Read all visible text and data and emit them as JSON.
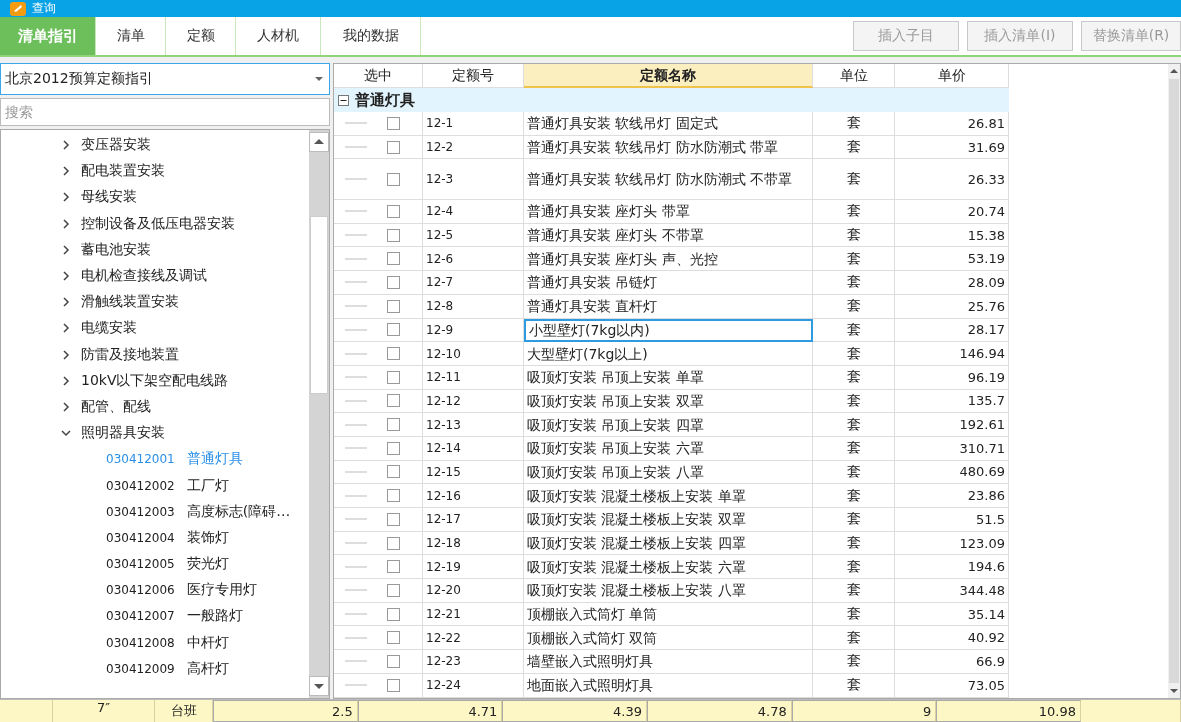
{
  "window": {
    "title": "查询"
  },
  "tabs": [
    {
      "label": "清单指引",
      "selected": true
    },
    {
      "label": "清单",
      "selected": false
    },
    {
      "label": "定额",
      "selected": false
    },
    {
      "label": "人材机",
      "selected": false
    },
    {
      "label": "我的数据",
      "selected": false
    }
  ],
  "toolbar_buttons": [
    {
      "label": "插入子目",
      "disabled": true
    },
    {
      "label": "插入清单(I)",
      "disabled": true
    },
    {
      "label": "替换清单(R)",
      "disabled": true
    }
  ],
  "library_select": {
    "value": "北京2012预算定额指引"
  },
  "search": {
    "placeholder": "搜索"
  },
  "tree": [
    {
      "label": "变压器安装",
      "expanded": false
    },
    {
      "label": "配电装置安装",
      "expanded": false
    },
    {
      "label": "母线安装",
      "expanded": false
    },
    {
      "label": "控制设备及低压电器安装",
      "expanded": false
    },
    {
      "label": "蓄电池安装",
      "expanded": false
    },
    {
      "label": "电机检查接线及调试",
      "expanded": false
    },
    {
      "label": "滑触线装置安装",
      "expanded": false
    },
    {
      "label": "电缆安装",
      "expanded": false
    },
    {
      "label": "防雷及接地装置",
      "expanded": false
    },
    {
      "label": "10kV以下架空配电线路",
      "expanded": false
    },
    {
      "label": "配管、配线",
      "expanded": false
    },
    {
      "label": "照明器具安装",
      "expanded": true,
      "children": [
        {
          "code": "030412001",
          "name": "普通灯具",
          "selected": true
        },
        {
          "code": "030412002",
          "name": "工厂灯",
          "selected": false
        },
        {
          "code": "030412003",
          "name": "高度标志(障碍…",
          "selected": false
        },
        {
          "code": "030412004",
          "name": "装饰灯",
          "selected": false
        },
        {
          "code": "030412005",
          "name": "荧光灯",
          "selected": false
        },
        {
          "code": "030412006",
          "name": "医疗专用灯",
          "selected": false
        },
        {
          "code": "030412007",
          "name": "一般路灯",
          "selected": false
        },
        {
          "code": "030412008",
          "name": "中杆灯",
          "selected": false
        },
        {
          "code": "030412009",
          "name": "高杆灯",
          "selected": false
        }
      ]
    }
  ],
  "table": {
    "columns": [
      "选中",
      "定额号",
      "定额名称",
      "单位",
      "单价"
    ],
    "group": {
      "label": "普通灯具",
      "expanded": true
    },
    "rows": [
      {
        "code": "12-1",
        "name": "普通灯具安装 软线吊灯 固定式",
        "unit": "套",
        "price": "26.81",
        "checked": false,
        "selected": false
      },
      {
        "code": "12-2",
        "name": "普通灯具安装 软线吊灯 防水防潮式 带罩",
        "unit": "套",
        "price": "31.69",
        "checked": false,
        "selected": false
      },
      {
        "code": "12-3",
        "name": "普通灯具安装 软线吊灯 防水防潮式 不带罩",
        "unit": "套",
        "price": "26.33",
        "checked": false,
        "selected": false
      },
      {
        "code": "12-4",
        "name": "普通灯具安装 座灯头 带罩",
        "unit": "套",
        "price": "20.74",
        "checked": false,
        "selected": false
      },
      {
        "code": "12-5",
        "name": "普通灯具安装 座灯头 不带罩",
        "unit": "套",
        "price": "15.38",
        "checked": false,
        "selected": false
      },
      {
        "code": "12-6",
        "name": "普通灯具安装 座灯头 声、光控",
        "unit": "套",
        "price": "53.19",
        "checked": false,
        "selected": false
      },
      {
        "code": "12-7",
        "name": "普通灯具安装 吊链灯",
        "unit": "套",
        "price": "28.09",
        "checked": false,
        "selected": false
      },
      {
        "code": "12-8",
        "name": "普通灯具安装 直杆灯",
        "unit": "套",
        "price": "25.76",
        "checked": false,
        "selected": false
      },
      {
        "code": "12-9",
        "name": "小型壁灯(7kg以内)",
        "unit": "套",
        "price": "28.17",
        "checked": false,
        "selected": true
      },
      {
        "code": "12-10",
        "name": "大型壁灯(7kg以上)",
        "unit": "套",
        "price": "146.94",
        "checked": false,
        "selected": false
      },
      {
        "code": "12-11",
        "name": "吸顶灯安装 吊顶上安装 单罩",
        "unit": "套",
        "price": "96.19",
        "checked": false,
        "selected": false
      },
      {
        "code": "12-12",
        "name": "吸顶灯安装 吊顶上安装 双罩",
        "unit": "套",
        "price": "135.7",
        "checked": false,
        "selected": false
      },
      {
        "code": "12-13",
        "name": "吸顶灯安装 吊顶上安装 四罩",
        "unit": "套",
        "price": "192.61",
        "checked": false,
        "selected": false
      },
      {
        "code": "12-14",
        "name": "吸顶灯安装 吊顶上安装 六罩",
        "unit": "套",
        "price": "310.71",
        "checked": false,
        "selected": false
      },
      {
        "code": "12-15",
        "name": "吸顶灯安装 吊顶上安装 八罩",
        "unit": "套",
        "price": "480.69",
        "checked": false,
        "selected": false
      },
      {
        "code": "12-16",
        "name": "吸顶灯安装 混凝土楼板上安装 单罩",
        "unit": "套",
        "price": "23.86",
        "checked": false,
        "selected": false
      },
      {
        "code": "12-17",
        "name": "吸顶灯安装 混凝土楼板上安装 双罩",
        "unit": "套",
        "price": "51.5",
        "checked": false,
        "selected": false
      },
      {
        "code": "12-18",
        "name": "吸顶灯安装 混凝土楼板上安装 四罩",
        "unit": "套",
        "price": "123.09",
        "checked": false,
        "selected": false
      },
      {
        "code": "12-19",
        "name": "吸顶灯安装 混凝土楼板上安装 六罩",
        "unit": "套",
        "price": "194.6",
        "checked": false,
        "selected": false
      },
      {
        "code": "12-20",
        "name": "吸顶灯安装 混凝土楼板上安装 八罩",
        "unit": "套",
        "price": "344.48",
        "checked": false,
        "selected": false
      },
      {
        "code": "12-21",
        "name": "顶棚嵌入式筒灯 单筒",
        "unit": "套",
        "price": "35.14",
        "checked": false,
        "selected": false
      },
      {
        "code": "12-22",
        "name": "顶棚嵌入式筒灯 双筒",
        "unit": "套",
        "price": "40.92",
        "checked": false,
        "selected": false
      },
      {
        "code": "12-23",
        "name": "墙壁嵌入式照明灯具",
        "unit": "套",
        "price": "66.9",
        "checked": false,
        "selected": false
      },
      {
        "code": "12-24",
        "name": "地面嵌入式照明灯具",
        "unit": "套",
        "price": "73.05",
        "checked": false,
        "selected": false
      }
    ]
  },
  "status_bar": [
    "7″",
    "台班",
    "2.5",
    "4.71",
    "4.39",
    "4.78",
    "9",
    "10.98"
  ]
}
